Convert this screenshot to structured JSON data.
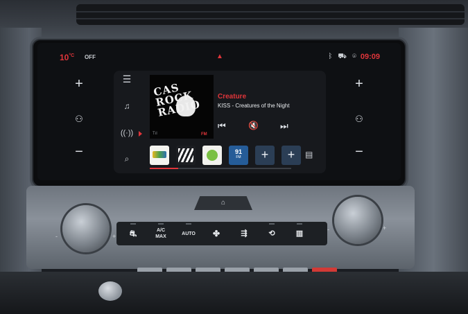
{
  "status_bar": {
    "temperature": "10",
    "temperature_unit": "°C",
    "climate_state": "OFF",
    "clock": "09:09",
    "icons": [
      "car-alert-icon",
      "bluetooth-icon",
      "car-connect-icon",
      "location-icon"
    ]
  },
  "left_panel": {
    "plus": "+",
    "minus": "−",
    "seat_icon": "seat-heat-icon"
  },
  "right_panel": {
    "plus": "+",
    "minus": "−",
    "seat_icon": "seat-heat-icon"
  },
  "nav": {
    "items": [
      "menu-icon",
      "music-icon",
      "radio-icon",
      "search-icon"
    ],
    "active": "radio-icon"
  },
  "now_playing": {
    "album_text": "CAS ROCK RADIO",
    "fm_label": "FM",
    "title": "Creature",
    "artist_album": "KISS - Creatures of the Night"
  },
  "presets": {
    "freq_value": "91",
    "freq_band": "FM",
    "add_1": "+",
    "add_2": "+"
  },
  "console": {
    "home_icon": "home-icon",
    "left_knob_minus": "-",
    "left_knob_plus": "+",
    "right_knob_minus": "-",
    "right_knob_plus": "+",
    "ac_max": "A/C MAX",
    "auto": "AUTO"
  },
  "colors": {
    "accent": "#e0353a",
    "screen_bg": "#0e1013",
    "preset_blue": "#255c98"
  }
}
